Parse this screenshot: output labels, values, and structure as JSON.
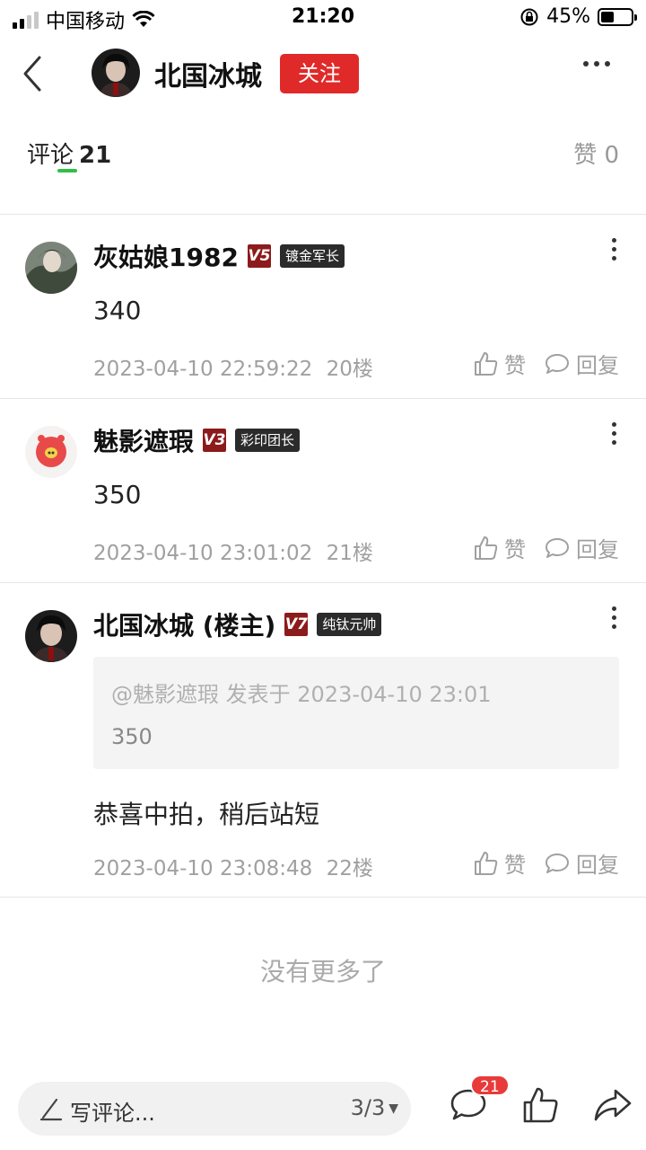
{
  "status_bar": {
    "carrier": "中国移动",
    "time": "21:20",
    "battery_percent": "45%",
    "battery_level": 0.45
  },
  "header": {
    "title": "北国冰城",
    "follow_label": "关注",
    "accent_color": "#e02a2a"
  },
  "tabs": {
    "comments_label": "评论",
    "comments_count": "21",
    "likes_label": "赞 0"
  },
  "comments": [
    {
      "name": "灰姑娘1982",
      "level": "V5",
      "rank": "镀金军长",
      "content": "340",
      "time": "2023-04-10 22:59:22",
      "floor": "20楼",
      "like_label": "赞",
      "reply_label": "回复"
    },
    {
      "name": "魅影遮瑕",
      "level": "V3",
      "rank": "彩印团长",
      "content": "350",
      "time": "2023-04-10 23:01:02",
      "floor": "21楼",
      "like_label": "赞",
      "reply_label": "回复"
    },
    {
      "name": "北国冰城 (楼主)",
      "level": "V7",
      "rank": "纯钛元帅",
      "quote_source": "@魅影遮瑕 发表于 2023-04-10 23:01",
      "quote_text": "350",
      "content": "恭喜中拍，稍后站短",
      "time": "2023-04-10 23:08:48",
      "floor": "22楼",
      "like_label": "赞",
      "reply_label": "回复"
    }
  ],
  "no_more": "没有更多了",
  "bottom_bar": {
    "write_placeholder": "写评论...",
    "page_indicator": "3/3",
    "comment_badge": "21"
  }
}
